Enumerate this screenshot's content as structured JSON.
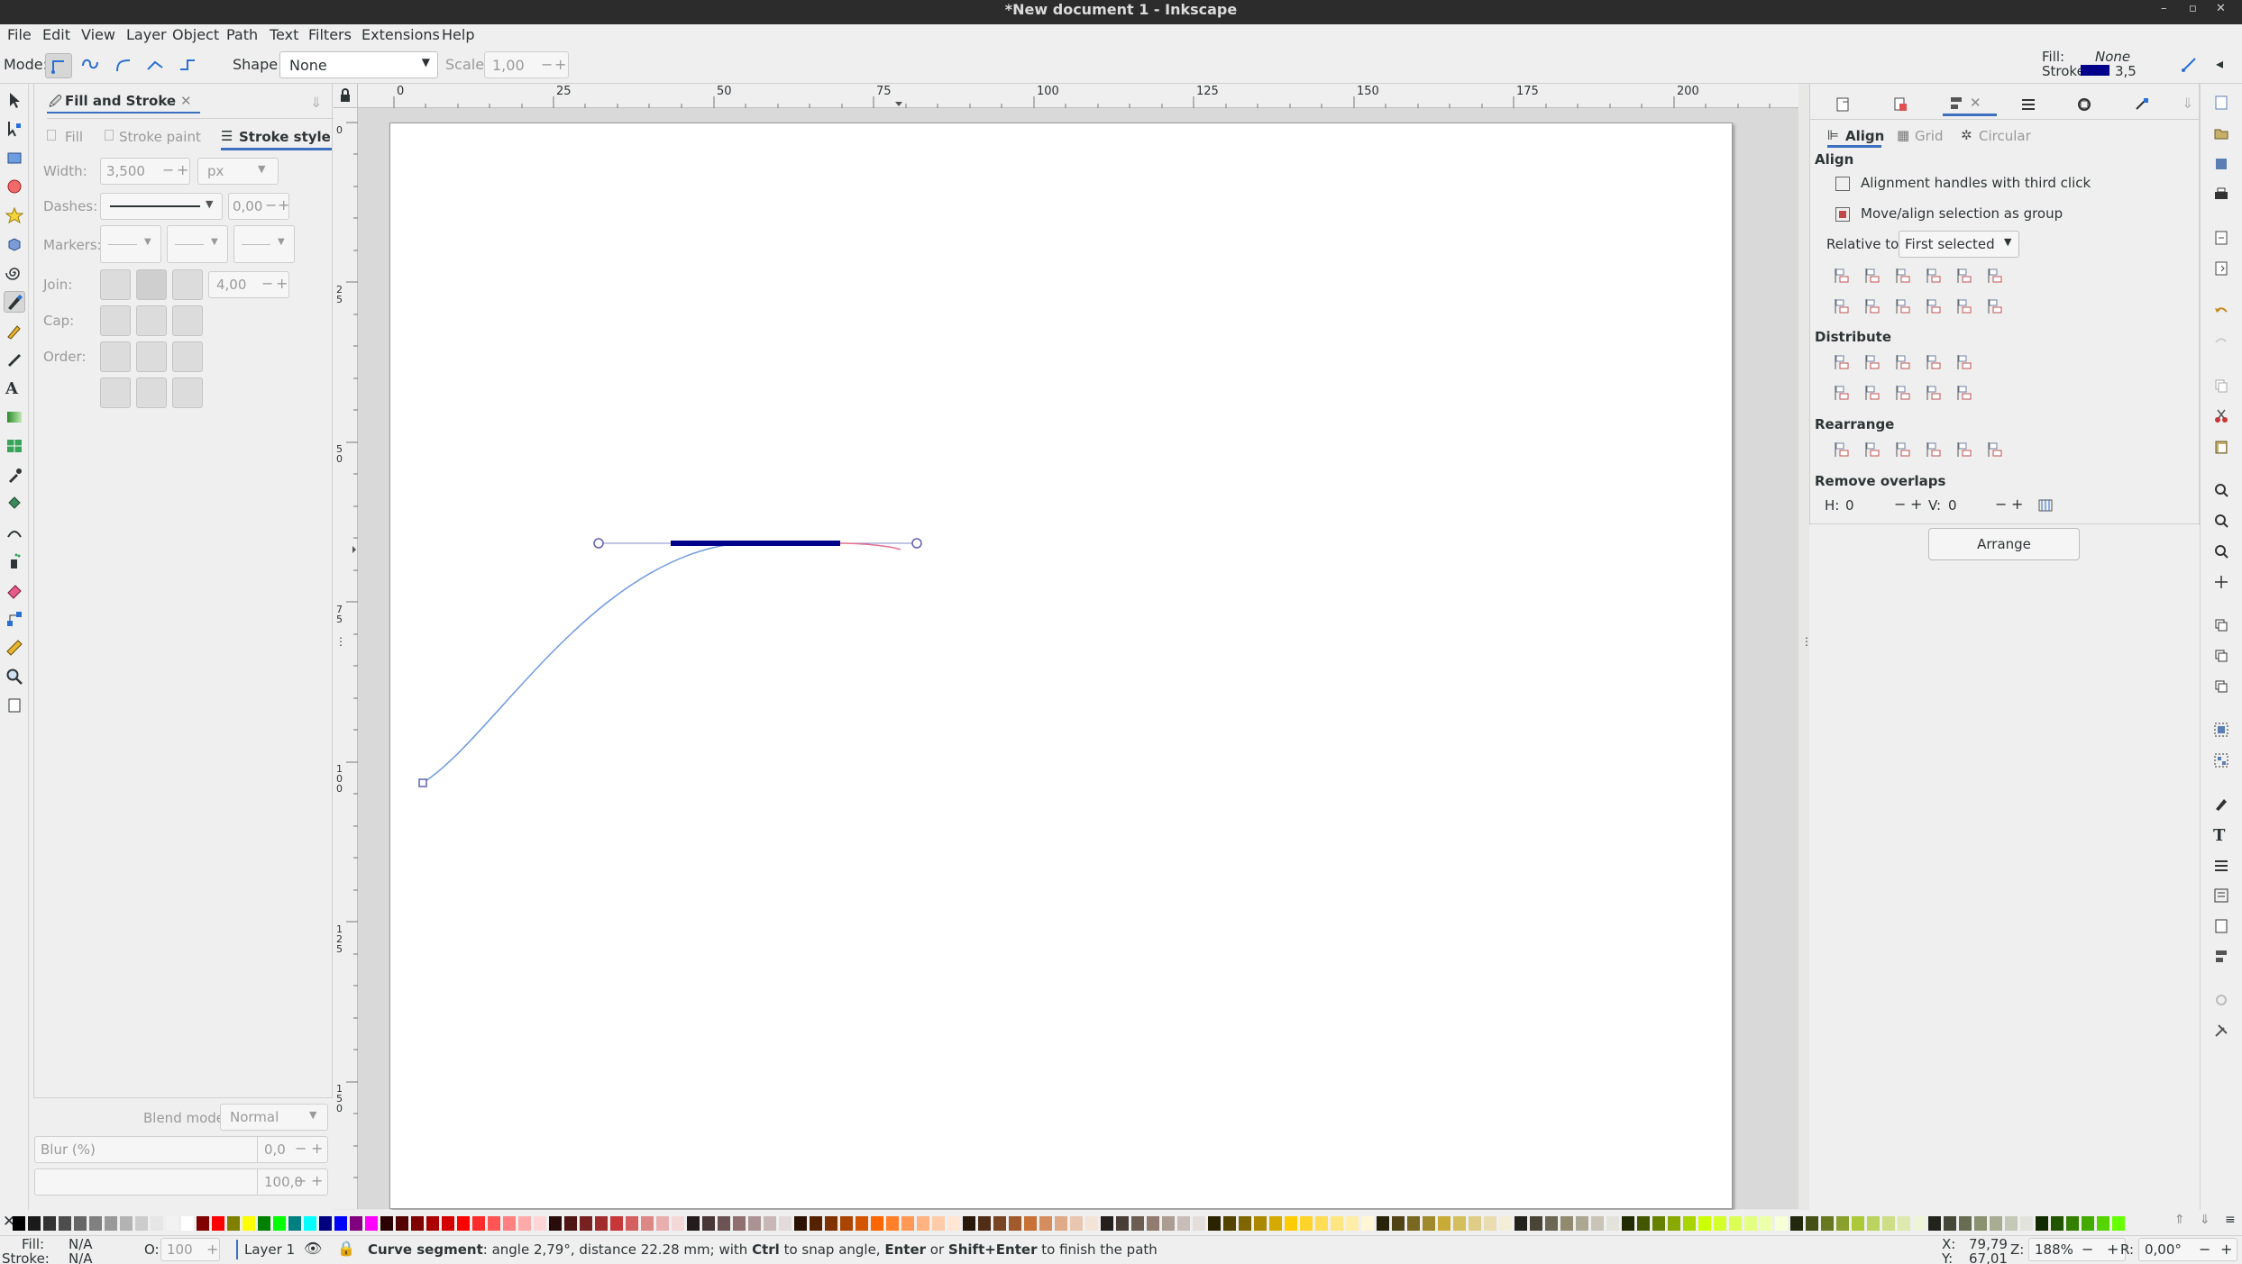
{
  "window": {
    "title": "*New document 1 - Inkscape"
  },
  "menu": [
    "File",
    "Edit",
    "View",
    "Layer",
    "Object",
    "Path",
    "Text",
    "Filters",
    "Extensions",
    "Help"
  ],
  "toolbar": {
    "mode_label": "Mode:",
    "shape_label": "Shape:",
    "shape_value": "None",
    "scale_label": "Scale:",
    "scale_value": "1,00",
    "fill_label": "Fill:",
    "fill_value": "None",
    "stroke_label": "Stroke:",
    "stroke_width": "3,5",
    "stroke_color": "#00008b"
  },
  "fill_stroke": {
    "dialog_title": "Fill and Stroke",
    "tabs": [
      "Fill",
      "Stroke paint",
      "Stroke style"
    ],
    "active_tab": "Stroke style",
    "width_label": "Width:",
    "width_value": "3,500",
    "unit": "px",
    "dashes_label": "Dashes:",
    "dash_offset": "0,00",
    "markers_label": "Markers:",
    "join_label": "Join:",
    "miter_value": "4,00",
    "cap_label": "Cap:",
    "order_label": "Order:",
    "blend_label": "Blend mode:",
    "blend_value": "Normal",
    "blur_label": "Blur (%)",
    "blur_value": "0,0",
    "opacity_value": "100,0"
  },
  "ruler": {
    "h_ticks": [
      "0",
      "25",
      "50",
      "75",
      "100",
      "125",
      "150",
      "175",
      "200"
    ],
    "v_ticks": [
      "0",
      "25",
      "50",
      "75",
      "100",
      "125",
      "150"
    ]
  },
  "align": {
    "tabs": [
      "Align",
      "Grid",
      "Circular"
    ],
    "section_align": "Align",
    "opt_third_click": "Alignment handles with third click",
    "opt_group": "Move/align selection as group",
    "relative_label": "Relative to:",
    "relative_value": "First selected",
    "section_distribute": "Distribute",
    "section_rearrange": "Rearrange",
    "section_overlaps": "Remove overlaps",
    "h_label": "H:",
    "h_value": "0",
    "v_label": "V:",
    "v_value": "0",
    "arrange_button": "Arrange"
  },
  "palette_colors": [
    "#000000",
    "#1a1a1a",
    "#333333",
    "#4d4d4d",
    "#666666",
    "#808080",
    "#999999",
    "#b3b3b3",
    "#cccccc",
    "#e6e6e6",
    "#f2f2f2",
    "#ffffff",
    "#800000",
    "#ff0000",
    "#808000",
    "#ffff00",
    "#008000",
    "#00ff00",
    "#008080",
    "#00ffff",
    "#000080",
    "#0000ff",
    "#800080",
    "#ff00ff",
    "#2b0000",
    "#550000",
    "#800000",
    "#aa0000",
    "#d40000",
    "#ff0000",
    "#ff2a2a",
    "#ff5555",
    "#ff8080",
    "#ffaaaa",
    "#ffd5d5",
    "#280b0b",
    "#501616",
    "#782121",
    "#a02c2c",
    "#c83737",
    "#d35f5f",
    "#de8787",
    "#e9afaf",
    "#f4d7d7",
    "#241c1c",
    "#483737",
    "#6c5353",
    "#916f6f",
    "#ac9393",
    "#c8b7b7",
    "#e3dbdb",
    "#2b1100",
    "#552200",
    "#803300",
    "#aa4400",
    "#d45500",
    "#ff6600",
    "#ff7f2a",
    "#ff9955",
    "#ffb380",
    "#ffccaa",
    "#ffe6d5",
    "#28170b",
    "#502d16",
    "#784421",
    "#a05a2c",
    "#c87137",
    "#d38d5f",
    "#deaa87",
    "#e9c6af",
    "#f4e3d7",
    "#241f1c",
    "#483e37",
    "#6c5d53",
    "#917c6f",
    "#ac9d93",
    "#c8beb7",
    "#e3dedb",
    "#2b2200",
    "#554400",
    "#806600",
    "#aa8800",
    "#d4aa00",
    "#ffcc00",
    "#ffd42a",
    "#ffdd55",
    "#ffe680",
    "#ffeeaa",
    "#fff6d5",
    "#28220b",
    "#504416",
    "#786721",
    "#a0892c",
    "#c8ab37",
    "#d4bf5f",
    "#decd87",
    "#e9ddaf",
    "#f4eed7",
    "#24221c",
    "#484537",
    "#6c6753",
    "#918a6f",
    "#aca793",
    "#c8c4b7",
    "#e3e2db",
    "#222b00",
    "#445500",
    "#668000",
    "#88aa00",
    "#aad400",
    "#ccff00",
    "#d4ff2a",
    "#ddff55",
    "#e5ff80",
    "#eeffaa",
    "#f6ffd5",
    "#22280b",
    "#445016",
    "#677821",
    "#89a02c",
    "#abc837",
    "#bcd35f",
    "#cdde87",
    "#dde9af",
    "#eef4d7",
    "#22241c",
    "#454837",
    "#676c53",
    "#8a916f",
    "#a7ac93",
    "#c4c8b7",
    "#e2e3db",
    "#112b00",
    "#225500",
    "#338000",
    "#44aa00",
    "#55d400",
    "#66ff00"
  ],
  "status": {
    "fill_label": "Fill:",
    "fill_value": "N/A",
    "stroke_label": "Stroke:",
    "stroke_value": "N/A",
    "opacity_label": "O:",
    "opacity_value": "100",
    "layer": "Layer 1",
    "message_bold": "Curve segment",
    "message_a": ": angle 2,79°, distance 22.28 mm; with ",
    "key_ctrl": "Ctrl",
    "message_b": " to snap angle, ",
    "key_enter": "Enter",
    "message_c": " or ",
    "key_shift_enter": "Shift+Enter",
    "message_d": " to finish the path",
    "x_label": "X:",
    "x_value": "79,79",
    "y_label": "Y:",
    "y_value": "67,01",
    "zoom_label": "Z:",
    "zoom_value": "188%",
    "rotate_label": "R:",
    "rotate_value": "0,00°"
  }
}
